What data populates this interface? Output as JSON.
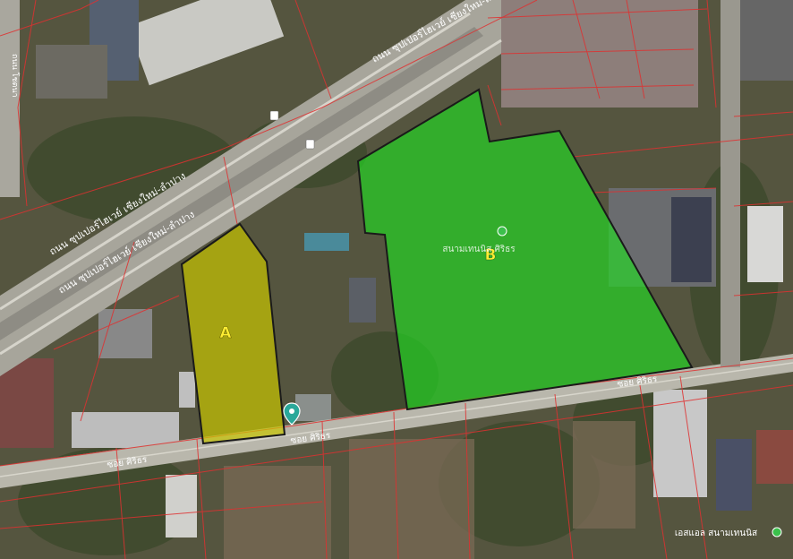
{
  "parcels": [
    {
      "id": "A",
      "label": "A",
      "fill": "#c8c400"
    },
    {
      "id": "B",
      "label": "B",
      "fill": "#22dd22"
    }
  ],
  "roads": {
    "highway_upper": "ถนน ซุปเปอร์ไฮเวย์ เชียงใหม่-ลำปาง",
    "highway_mid": "ถนน ซุปเปอร์ไฮเวย์ เชียงใหม่-ลำปาง",
    "highway_lower": "ถนน ซุปเปอร์ไฮเวย์ เชียงใหม่-ลำปาง",
    "soi_1": "ซอย ศิริธร",
    "soi_2": "ซอย ศิริธร",
    "soi_3": "ซอย ศิริธร",
    "side_road": "ถนน โชตนา"
  },
  "places": {
    "tennis_court": "สนามเทนนิส ศิริธร",
    "tennis_bottom_right": "เอสแอล สนามเทนนิส"
  },
  "colors": {
    "parcel_line": "#e03030",
    "road": "#b9b7ac",
    "label_yellow": "#ffee33",
    "pin": "#2aa89a"
  },
  "icons": [
    "location-pin-icon",
    "green-place-marker-icon",
    "bus-stop-icon"
  ]
}
